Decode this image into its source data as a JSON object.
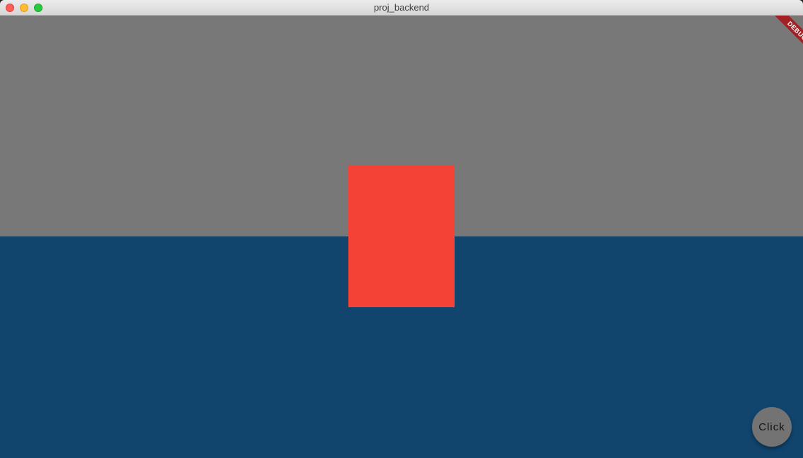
{
  "window": {
    "title": "proj_backend"
  },
  "colors": {
    "top_background": "#787878",
    "bottom_background": "#11456e",
    "red_box": "#f44336",
    "fab_background": "#737373",
    "debug_ribbon": "#a52025"
  },
  "debug_banner": {
    "label": "DEBUG"
  },
  "fab": {
    "label": "Click"
  }
}
